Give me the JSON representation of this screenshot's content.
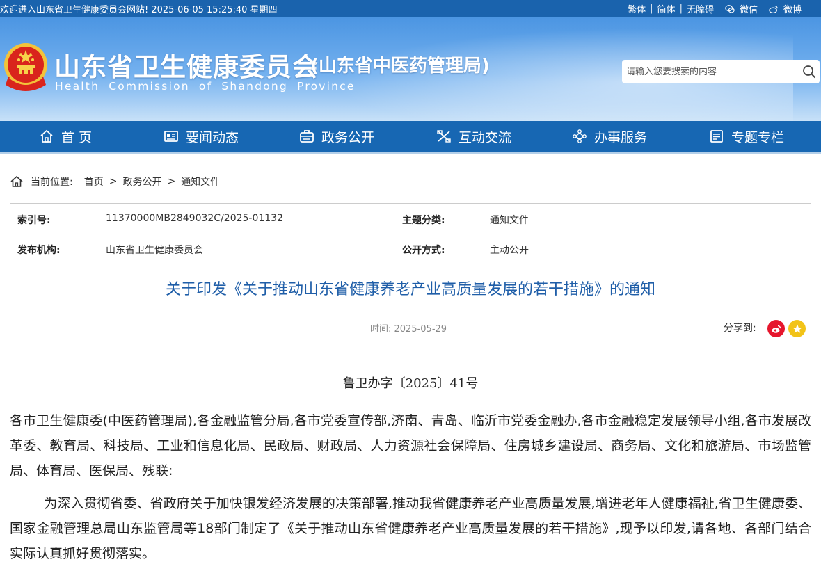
{
  "topbar": {
    "welcome": "欢迎进入山东省卫生健康委员会网站! 2025-06-05 15:25:40 星期四",
    "links": [
      "繁体",
      "简体",
      "无障碍"
    ],
    "social": [
      "微信",
      "微博"
    ]
  },
  "header": {
    "title": "山东省卫生健康委员会",
    "subtitle": "(山东省中医药管理局)",
    "english": "Health Commission of Shandong Province",
    "search_placeholder": "请输入您要搜索的内容"
  },
  "nav": {
    "items": [
      {
        "label": "首 页",
        "icon": "home-icon"
      },
      {
        "label": "要闻动态",
        "icon": "news-icon"
      },
      {
        "label": "政务公开",
        "icon": "briefcase-icon"
      },
      {
        "label": "互动交流",
        "icon": "chat-icon"
      },
      {
        "label": "办事服务",
        "icon": "service-icon"
      },
      {
        "label": "专题专栏",
        "icon": "column-icon"
      }
    ]
  },
  "breadcrumb": {
    "label": "当前位置:",
    "items": [
      "首页",
      "政务公开",
      "通知文件"
    ],
    "separator": ">"
  },
  "meta": {
    "index_label": "索引号:",
    "index_value": "11370000MB2849032C/2025-01132",
    "topic_label": "主题分类:",
    "topic_value": "通知文件",
    "publisher_label": "发布机构:",
    "publisher_value": "山东省卫生健康委员会",
    "method_label": "公开方式:",
    "method_value": "主动公开"
  },
  "article": {
    "title": "关于印发《关于推动山东省健康养老产业高质量发展的若干措施》的通知",
    "time": "时间: 2025-05-29",
    "share_label": "分享到:",
    "doc_number": "鲁卫办字〔2025〕41号",
    "addressees": "各市卫生健康委(中医药管理局),各金融监管分局,各市党委宣传部,济南、青岛、临沂市党委金融办,各市金融稳定发展领导小组,各市发展改革委、教育局、科技局、工业和信息化局、民政局、财政局、人力资源社会保障局、住房城乡建设局、商务局、文化和旅游局、市场监管局、体育局、医保局、残联:",
    "body": "为深入贯彻省委、省政府关于加快银发经济发展的决策部署,推动我省健康养老产业高质量发展,增进老年人健康福祉,省卫生健康委、国家金融管理总局山东监管局等18部门制定了《关于推动山东省健康养老产业高质量发展的若干措施》,现予以印发,请各地、各部门结合实际认真抓好贯彻落实。"
  },
  "colors": {
    "topbar": "#1a63ad",
    "nav": "#1767b3",
    "title": "#1f5ea8",
    "weibo": "#e6162d",
    "favorite": "#f2c318"
  }
}
